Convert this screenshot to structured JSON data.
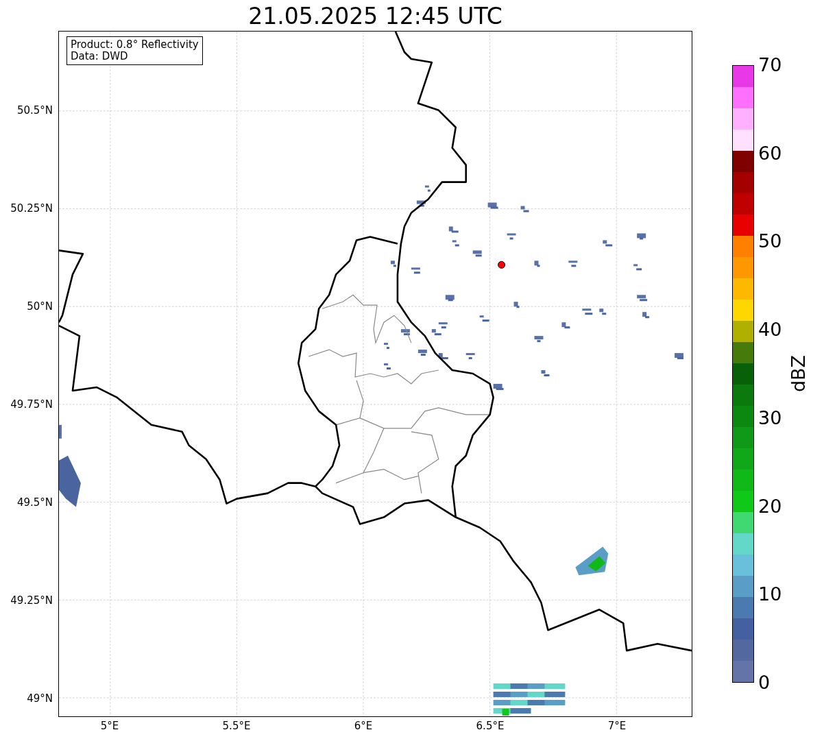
{
  "title": "21.05.2025 12:45 UTC",
  "legend": {
    "lines": [
      "Product: 0.8° Reflectivity",
      "Data: DWD"
    ]
  },
  "map": {
    "lat_ticks": [
      "50.5°N",
      "50.25°N",
      "50°N",
      "49.75°N",
      "49.5°N",
      "49.25°N",
      "49°N"
    ],
    "lon_ticks": [
      "5°E",
      "5.5°E",
      "6°E",
      "6.5°E",
      "7°E"
    ]
  },
  "colorbar": {
    "label": "dBZ",
    "ticks": [
      "70",
      "60",
      "50",
      "40",
      "30",
      "20",
      "10",
      "0"
    ],
    "bins": [
      {
        "color": "#e838e8"
      },
      {
        "color": "#ff70ff"
      },
      {
        "color": "#ffb0ff"
      },
      {
        "color": "#ffe0ff"
      },
      {
        "color": "#800000"
      },
      {
        "color": "#a40000"
      },
      {
        "color": "#c00000"
      },
      {
        "color": "#e80000"
      },
      {
        "color": "#ff7f00"
      },
      {
        "color": "#ff9800"
      },
      {
        "color": "#ffb800"
      },
      {
        "color": "#ffd700"
      },
      {
        "color": "#b0b000"
      },
      {
        "color": "#467a0a"
      },
      {
        "color": "#086008"
      },
      {
        "color": "#0a7a0c"
      },
      {
        "color": "#0c8810"
      },
      {
        "color": "#109818"
      },
      {
        "color": "#10a818"
      },
      {
        "color": "#10b818"
      },
      {
        "color": "#10c818"
      },
      {
        "color": "#40d870"
      },
      {
        "color": "#64d8c8"
      },
      {
        "color": "#68c0da"
      },
      {
        "color": "#5a9ec8"
      },
      {
        "color": "#4a7ab0"
      },
      {
        "color": "#4460a0"
      },
      {
        "color": "#5468a0"
      },
      {
        "color": "#6574a8"
      }
    ]
  }
}
